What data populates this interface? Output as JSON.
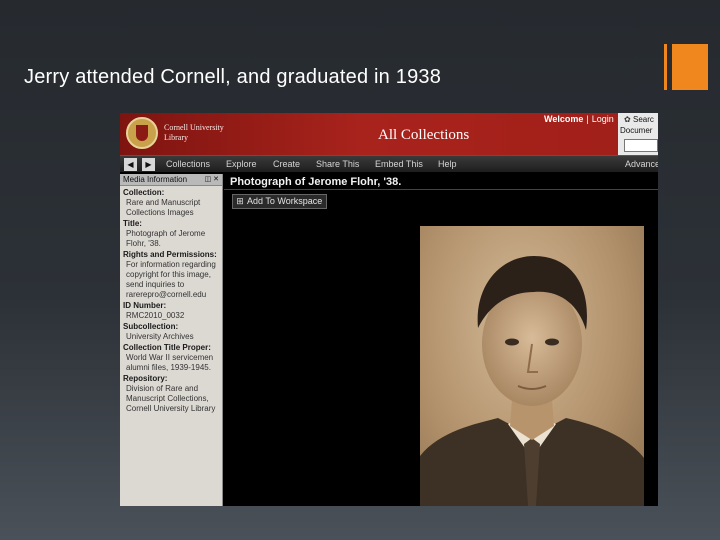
{
  "slide": {
    "title": "Jerry attended Cornell, and graduated in 1938",
    "accent_color": "#f0871e"
  },
  "banner": {
    "logo_line1": "Cornell University",
    "logo_line2": "Library",
    "title": "All Collections",
    "welcome": "Welcome",
    "separator": "|",
    "login": "Login",
    "search_label": "Searc",
    "search_label2": "Documer",
    "brand_color": "#a8231c"
  },
  "nav": {
    "back_icon": "chevron-left-icon",
    "forward_icon": "chevron-right-icon",
    "items": [
      {
        "label": "Collections"
      },
      {
        "label": "Explore"
      },
      {
        "label": "Create"
      },
      {
        "label": "Share This"
      },
      {
        "label": "Embed This"
      },
      {
        "label": "Help"
      }
    ],
    "advanced": "Advance"
  },
  "sidebar": {
    "header": "Media Information",
    "fields": [
      {
        "key": "Collection:",
        "value": "Rare and Manuscript Collections Images"
      },
      {
        "key": "Title:",
        "value": "Photograph of Jerome Flohr, '38."
      },
      {
        "key": "Rights and Permissions:",
        "value": "For information regarding copyright for this image, send inquiries to rarerepro@cornell.edu"
      },
      {
        "key": "ID Number:",
        "value": "RMC2010_0032"
      },
      {
        "key": "Subcollection:",
        "value": "University Archives"
      },
      {
        "key": "Collection Title Proper:",
        "value": "World War II servicemen alumni files, 1939-1945."
      },
      {
        "key": "Repository:",
        "value": "Division of Rare and Manuscript Collections, Cornell University Library"
      }
    ]
  },
  "viewer": {
    "title": "Photograph of Jerome Flohr, '38.",
    "add_button": "Add To Workspace"
  }
}
